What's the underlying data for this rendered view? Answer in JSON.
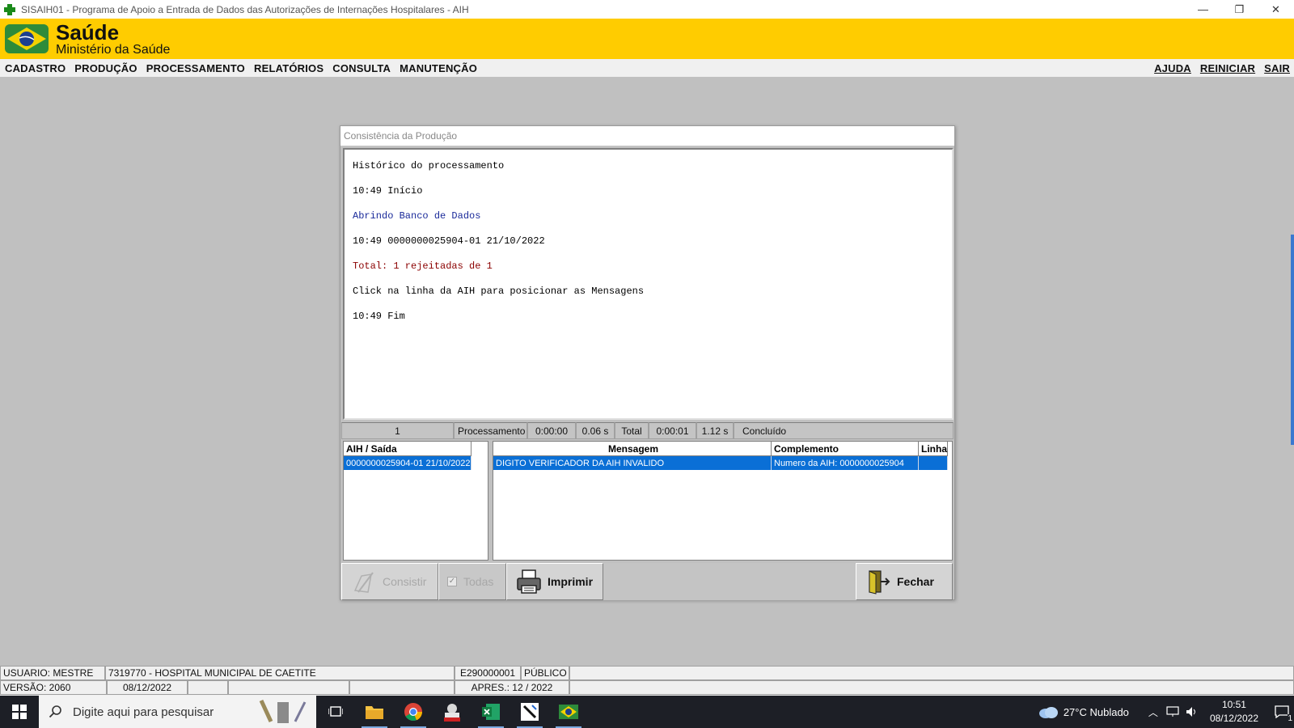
{
  "window": {
    "title": "SISAIH01 - Programa de Apoio a Entrada de Dados das Autorizações de Internações Hospitalares - AIH",
    "minimize": "—",
    "restore": "❐",
    "close": "✕"
  },
  "header": {
    "brand": "Saúde",
    "ministry": "Ministério da Saúde"
  },
  "menu": {
    "left": [
      "CADASTRO",
      "PRODUÇÃO",
      "PROCESSAMENTO",
      "RELATÓRIOS",
      "CONSULTA",
      "MANUTENÇÃO"
    ],
    "right": [
      "AJUDA",
      "REINICIAR",
      "SAIR"
    ]
  },
  "dialog": {
    "title": "Consistência da Produção",
    "log": {
      "heading": "Histórico do processamento",
      "start": "10:49  Início",
      "opening": "Abrindo Banco de Dados",
      "record": "10:49  0000000025904-01 21/10/2022",
      "total": "Total: 1 rejeitadas de 1",
      "hint": "Click na linha da AIH para posicionar as Mensagens",
      "end": "10:49  Fim"
    },
    "status": {
      "count": "1",
      "proc_label": "Processamento",
      "proc_time": "0:00:00",
      "proc_secs": "0.06 s",
      "total_label": "Total",
      "total_time": "0:00:01",
      "total_secs": "1.12 s",
      "state": "Concluído"
    },
    "aih_list": {
      "header": "AIH / Saída",
      "rows": [
        "0000000025904-01 21/10/2022"
      ]
    },
    "messages": {
      "headers": [
        "Mensagem",
        "Complemento",
        "Linha"
      ],
      "rows": [
        {
          "mensagem": "DIGITO VERIFICADOR DA AIH INVALIDO",
          "complemento": "Numero da AIH: 0000000025904",
          "linha": ""
        }
      ]
    },
    "buttons": {
      "consistir": "Consistir",
      "todas": "Todas",
      "imprimir": "Imprimir",
      "fechar": "Fechar"
    }
  },
  "statusbar": {
    "usuario": "USUARIO: MESTRE",
    "hospital": "7319770 - HOSPITAL MUNICIPAL DE CAETITE",
    "code": "E290000001",
    "tipo": "PÚBLICO",
    "versao": "VERSÃO: 2060",
    "data": "08/12/2022",
    "apres": "APRES.: 12 / 2022"
  },
  "taskbar": {
    "search_placeholder": "Digite aqui para pesquisar",
    "weather": "27°C  Nublado",
    "time": "10:51",
    "date": "08/12/2022",
    "notifications": "1"
  },
  "colors": {
    "header_yellow": "#ffcc00",
    "selection_blue": "#0a6fd6",
    "log_blue": "#1a2a9a",
    "log_red": "#8b0000"
  }
}
